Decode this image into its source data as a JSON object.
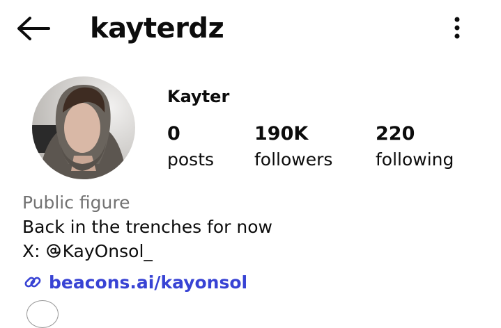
{
  "header": {
    "username": "kayterdz",
    "back_icon": "arrow-left-icon",
    "more_icon": "more-vertical-icon"
  },
  "profile": {
    "display_name": "Kayter",
    "avatar": "profile-photo"
  },
  "stats": [
    {
      "value": "0",
      "label": "posts"
    },
    {
      "value": "190K",
      "label": "followers"
    },
    {
      "value": "220",
      "label": "following"
    }
  ],
  "bio": {
    "category": "Public figure",
    "text": "Back in the trenches for now",
    "social_prefix": "X:",
    "social_icon": "threads-at-icon",
    "social_handle": "KayOnsol_",
    "link_icon": "link-icon",
    "link_text": "beacons.ai/kayonsol"
  },
  "colors": {
    "text": "#0c0c0c",
    "secondary": "#737373",
    "link": "#3843d4",
    "background": "#ffffff"
  }
}
